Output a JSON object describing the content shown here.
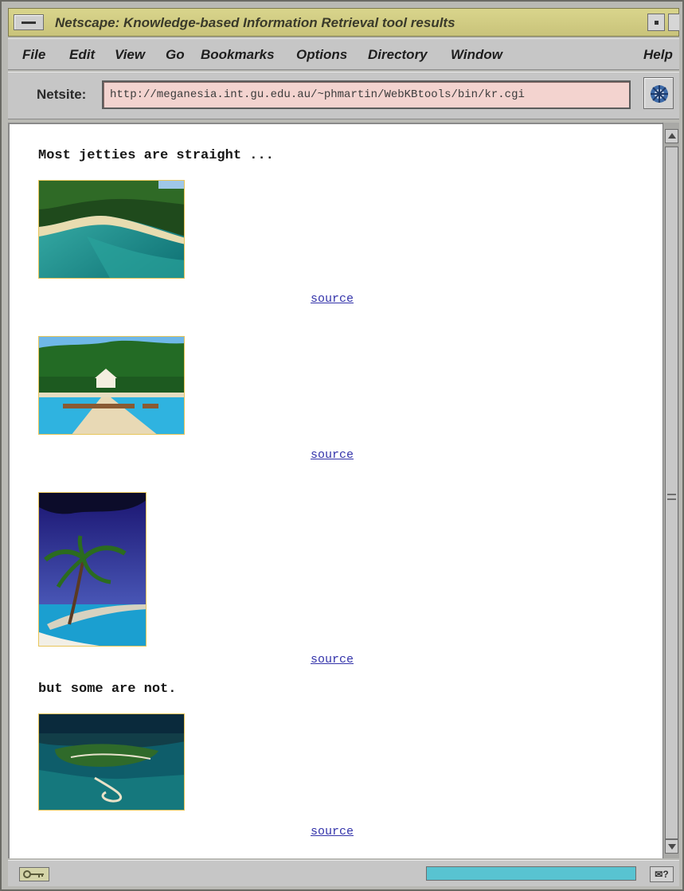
{
  "window": {
    "title": "Netscape: Knowledge-based Information Retrieval tool results"
  },
  "menu": {
    "items": [
      "File",
      "Edit",
      "View",
      "Go",
      "Bookmarks",
      "Options",
      "Directory",
      "Window"
    ],
    "help": "Help"
  },
  "location": {
    "label": "Netsite:",
    "url": "http://meganesia.int.gu.edu.au/~phmartin/WebKBtools/bin/kr.cgi"
  },
  "page": {
    "intro_text": "Most jetties are straight ...",
    "contrast_text": "but some are not.",
    "results": [
      {
        "image": "tropical-beach-photo",
        "link_text": "source"
      },
      {
        "image": "straight-jetty-photo",
        "link_text": "source"
      },
      {
        "image": "palm-tree-jetty-photo",
        "link_text": "source"
      },
      {
        "image": "curved-jetty-island-photo",
        "link_text": "source"
      }
    ]
  },
  "status": {
    "progress_fraction": 1.0
  },
  "colors": {
    "title_bar": "#d9d58c",
    "url_field": "#f3d3cf",
    "link": "#3333aa",
    "progress": "#58c3d1"
  }
}
